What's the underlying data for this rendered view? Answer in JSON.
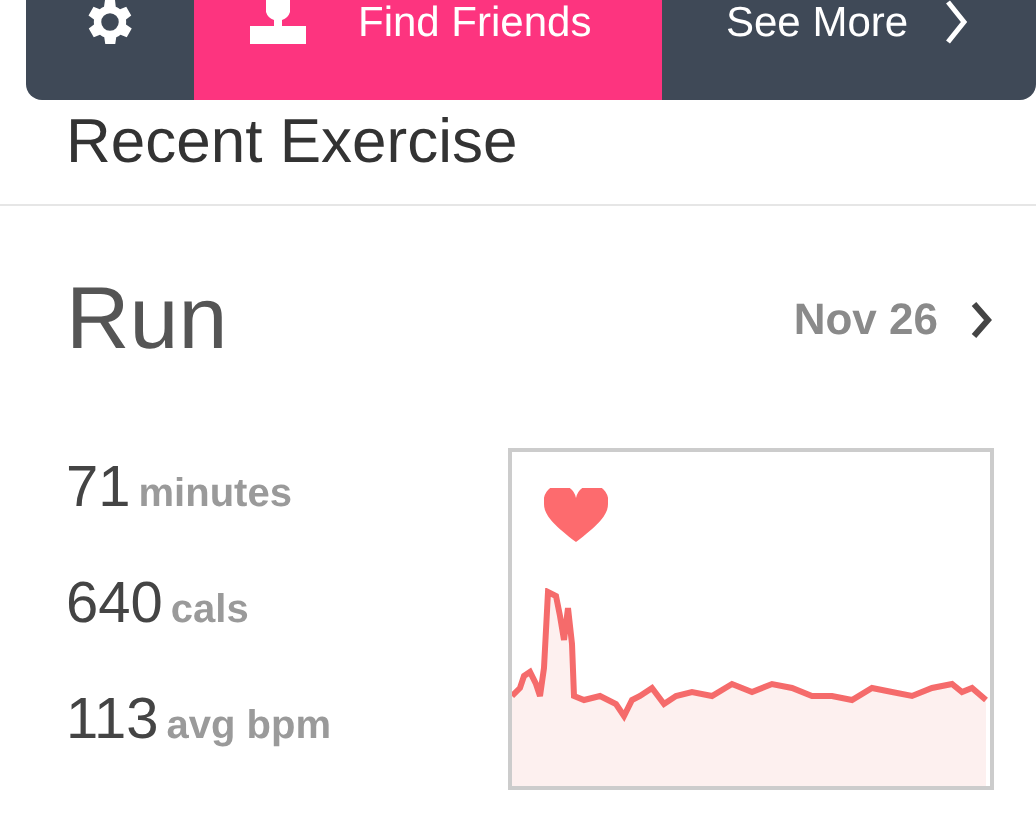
{
  "top_bar": {
    "items": [
      {
        "kind": "settings"
      },
      {
        "kind": "friends",
        "label": "Find Friends"
      },
      {
        "kind": "more",
        "label": "See More"
      }
    ]
  },
  "section_title": "Recent Exercise",
  "activity": {
    "name": "Run",
    "date": "Nov 26",
    "stats": [
      {
        "value": "71",
        "unit": "minutes"
      },
      {
        "value": "640",
        "unit": "cals"
      },
      {
        "value": "113",
        "unit": "avg bpm"
      }
    ]
  }
}
